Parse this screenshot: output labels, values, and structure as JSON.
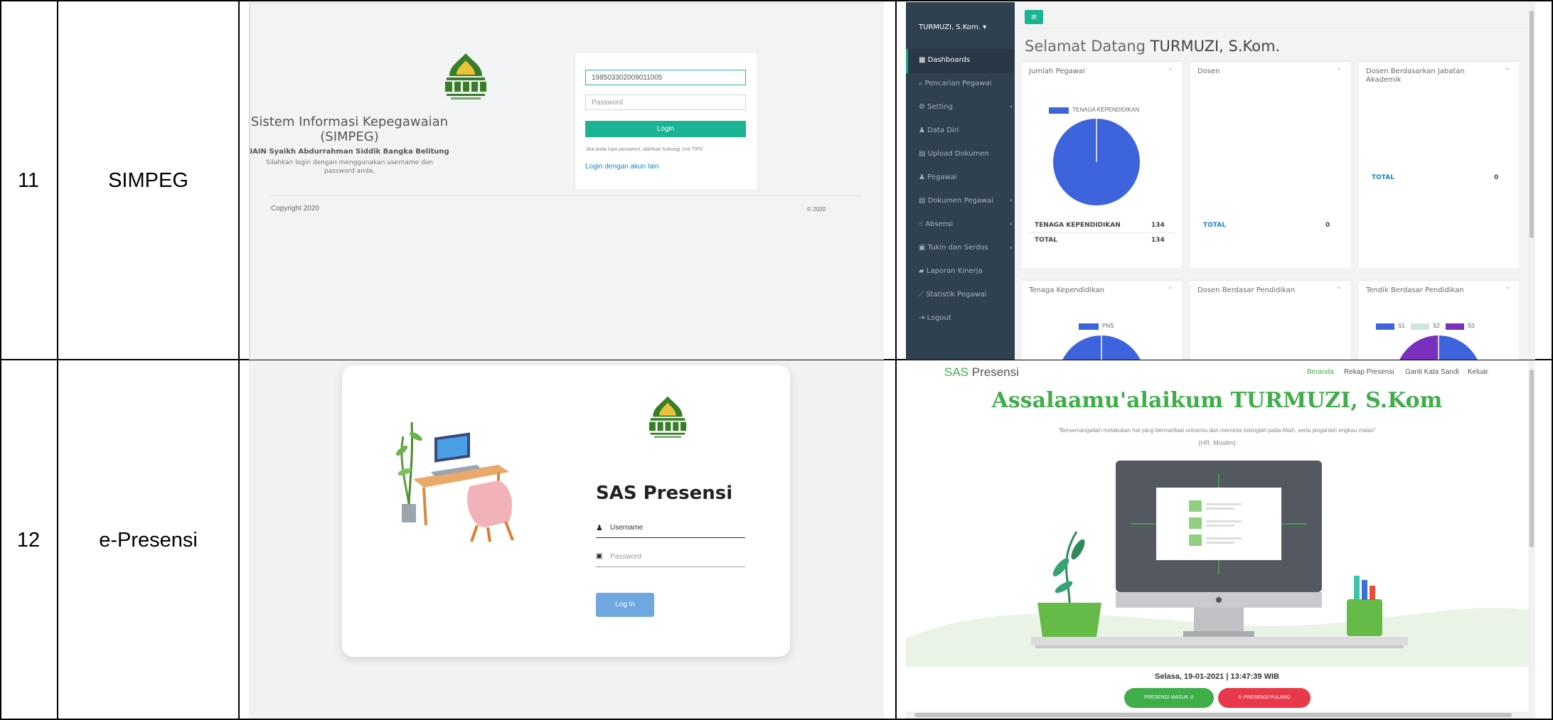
{
  "rows": [
    {
      "number": "11",
      "name": "SIMPEG"
    },
    {
      "number": "12",
      "name": "e-Presensi"
    }
  ],
  "simpeg_login": {
    "title_line1": "Sistem Informasi Kepegawaian",
    "title_line2": "(SIMPEG)",
    "institution": "IAIN Syaikh Abdurrahman Siddik Bangka Belitung",
    "instruction_line1": "Silahkan login dengan menggunakan username dan",
    "instruction_line2": "password anda.",
    "username_value": "198503302009011005",
    "password_placeholder": "Password",
    "login_button": "Login",
    "forgot_note": "Jika anda lupa password, silahkan hubungi Unit TIPD",
    "alt_login_link": "Login dengan akun lain",
    "copyright_left": "Copyright 2020",
    "copyright_right": "© 2020",
    "accent_color": "#1ab394"
  },
  "simpeg_dashboard": {
    "user_menu": "TURMUZI, S.Kom. ▾",
    "hamburger_icon": "≡",
    "welcome_prefix": "Selamat Datang",
    "welcome_name": "TURMUZI, S.Kom.",
    "menu": [
      {
        "label": "Dashboards",
        "icon": "grid-icon"
      },
      {
        "label": "Pencarian Pegawai",
        "icon": "search-icon"
      },
      {
        "label": "Setting",
        "icon": "gears-icon"
      },
      {
        "label": "Data Diri",
        "icon": "user-icon"
      },
      {
        "label": "Upload Dokumen",
        "icon": "document-icon"
      },
      {
        "label": "Pegawai",
        "icon": "users-icon"
      },
      {
        "label": "Dokumen Pegawai",
        "icon": "document-icon"
      },
      {
        "label": "Absensi",
        "icon": "hand-icon"
      },
      {
        "label": "Tukin dan Serdos",
        "icon": "file-icon"
      },
      {
        "label": "Laporan Kinerja",
        "icon": "book-icon"
      },
      {
        "label": "Statistik Pegawai",
        "icon": "chart-icon"
      },
      {
        "label": "Logout",
        "icon": "logout-icon"
      }
    ],
    "panels_top": [
      {
        "title": "Jumlah Pegawai",
        "legend": "TENAGA KEPENDIDIKAN",
        "rows": [
          [
            "TENAGA KEPENDIDIKAN",
            "134"
          ],
          [
            "TOTAL",
            "134"
          ]
        ]
      },
      {
        "title": "Dosen",
        "rows": [
          [
            "TOTAL",
            "0"
          ]
        ]
      },
      {
        "title_line1": "Dosen Berdasarkan Jabatan",
        "title_line2": "Akademik",
        "rows": [
          [
            "TOTAL",
            "0"
          ]
        ]
      }
    ],
    "panels_bottom": [
      {
        "title": "Tenaga Kependidikan",
        "legend": "PNS"
      },
      {
        "title": "Dosen Berdasar Pendidikan"
      },
      {
        "title": "Tendik Berdasar Pendidikan",
        "legend": [
          "S1",
          "S2",
          "S3"
        ]
      }
    ],
    "colors": {
      "sidebar": "#2f4050",
      "pie_blue": "#3d63dd",
      "s2": "#cfe3e0",
      "s3": "#7b2fbf",
      "link": "#1c84c6"
    }
  },
  "presensi_login": {
    "title": "SAS Presensi",
    "username_placeholder": "Username",
    "password_placeholder": "Password",
    "login_button": "Log In",
    "button_color": "#6fa8e0"
  },
  "presensi_home": {
    "brand_prefix": "SAS",
    "brand_suffix": "Presensi",
    "nav": [
      "Beranda",
      "Rekap Presensi",
      "Ganti Kata Sandi",
      "Keluar"
    ],
    "greeting": "Assalaamu'alaikum TURMUZI, S.Kom",
    "quote": "\"Bersemangatlah melakukan hal yang bermanfaat untukmu dan meminta tolonglah pada Allah, serta janganlah engkau malas\"",
    "quote_source": "(HR. Muslim)",
    "datetime": "Selasa, 19-01-2021 | 13:47:39 WIB",
    "btn_masuk": "PRESENSI MASUK ⊙",
    "btn_pulang": "⊙ PRESENSI PULANG",
    "colors": {
      "green": "#3fae49",
      "red": "#e8394a"
    }
  }
}
